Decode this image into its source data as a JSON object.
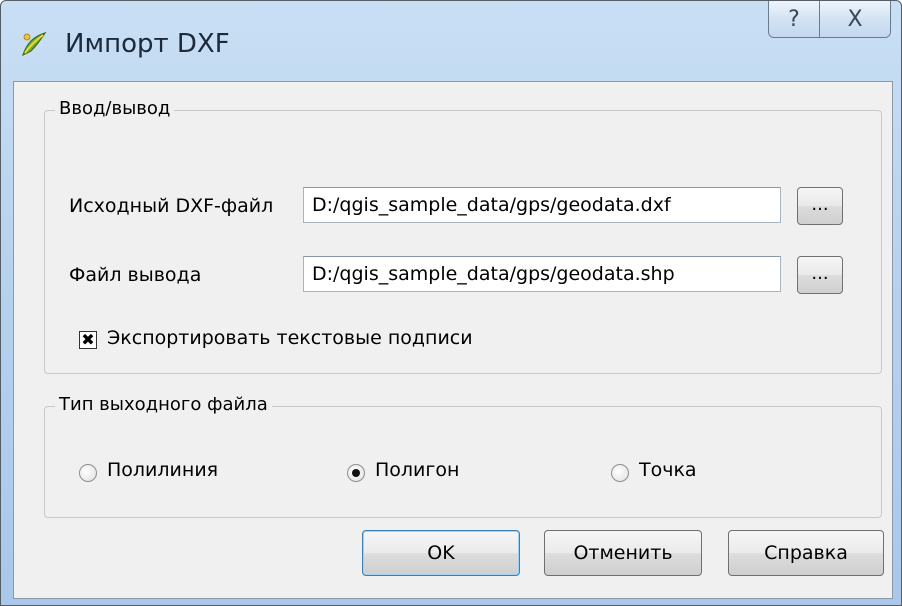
{
  "window": {
    "title": "Импорт DXF",
    "help_button_label": "?",
    "close_button_label": "X"
  },
  "io_group": {
    "title": "Ввод/вывод",
    "source_label": "Исходный DXF-файл",
    "source_value": "D:/qgis_sample_data/gps/geodata.dxf",
    "output_label": "Файл вывода",
    "output_value": "D:/qgis_sample_data/gps/geodata.shp",
    "browse_label": "...",
    "export_text_label": "Экспортировать текстовые подписи",
    "export_text_checked": true,
    "check_mark": "✖"
  },
  "type_group": {
    "title": "Тип выходного файла",
    "options": [
      {
        "label": "Полилиния",
        "selected": false
      },
      {
        "label": "Полигон",
        "selected": true
      },
      {
        "label": "Точка",
        "selected": false
      }
    ]
  },
  "buttons": {
    "ok": "OK",
    "cancel": "Отменить",
    "help": "Справка"
  },
  "colors": {
    "titlebar": "#b7d2ee",
    "dialog_bg": "#f0f0f0",
    "default_button_border": "#3c7fb1"
  }
}
